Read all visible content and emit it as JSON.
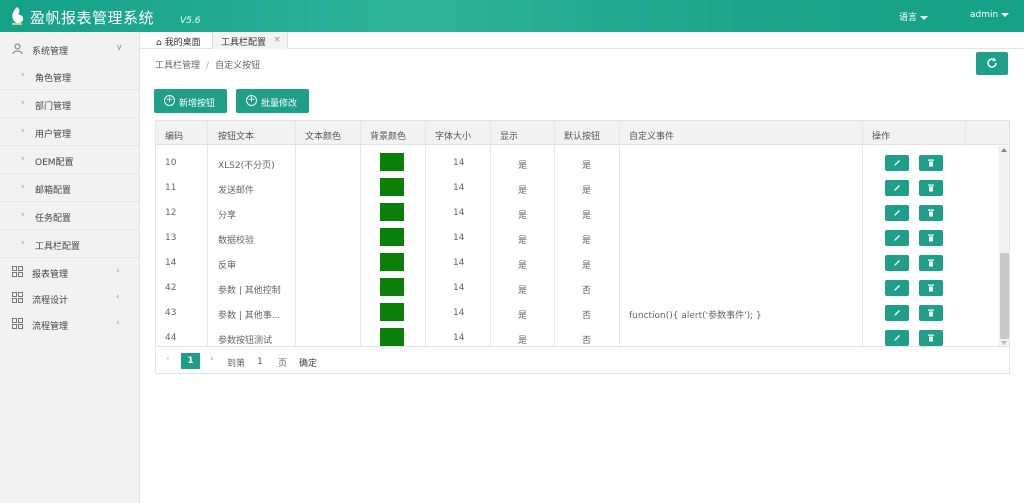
{
  "header": {
    "title": "盈帆报表管理系统",
    "version": "V5.6",
    "language": "语言",
    "user": "admin"
  },
  "sidebar": {
    "groups": [
      {
        "label": "系统管理",
        "icon": "user-icon",
        "expanded": true
      },
      {
        "label": "报表管理",
        "icon": "grid-icon",
        "expanded": false
      },
      {
        "label": "流程设计",
        "icon": "grid-icon",
        "expanded": false
      },
      {
        "label": "流程管理",
        "icon": "grid-icon",
        "expanded": false
      }
    ],
    "sub_items": [
      "角色管理",
      "部门管理",
      "用户管理",
      "OEM配置",
      "邮箱配置",
      "任务配置",
      "工具栏配置"
    ]
  },
  "tabs": {
    "home": "我的桌面",
    "active": "工具栏配置"
  },
  "breadcrumb": {
    "parent": "工具栏管理",
    "current": "自定义按钮"
  },
  "actions": {
    "add": "新增按钮",
    "batch_edit": "批量修改"
  },
  "table": {
    "columns": [
      "编码",
      "按钮文本",
      "文本颜色",
      "背景颜色",
      "字体大小",
      "显示",
      "默认按钮",
      "自定义事件",
      "操作"
    ],
    "rows": [
      {
        "code": "10",
        "text": "XLS2(不分页)",
        "color": "",
        "bg": "#0a7f0a",
        "size": "14",
        "show": "是",
        "default": "是",
        "event": ""
      },
      {
        "code": "11",
        "text": "发送邮件",
        "color": "",
        "bg": "#0a7f0a",
        "size": "14",
        "show": "是",
        "default": "是",
        "event": ""
      },
      {
        "code": "12",
        "text": "分享",
        "color": "",
        "bg": "#0a7f0a",
        "size": "14",
        "show": "是",
        "default": "是",
        "event": ""
      },
      {
        "code": "13",
        "text": "数据校验",
        "color": "",
        "bg": "#0a7f0a",
        "size": "14",
        "show": "是",
        "default": "是",
        "event": ""
      },
      {
        "code": "14",
        "text": "反审",
        "color": "",
        "bg": "#0a7f0a",
        "size": "14",
        "show": "是",
        "default": "是",
        "event": ""
      },
      {
        "code": "42",
        "text": "参数 | 其他控制",
        "color": "",
        "bg": "#0a7f0a",
        "size": "14",
        "show": "是",
        "default": "否",
        "event": ""
      },
      {
        "code": "43",
        "text": "参数 | 其他事...",
        "color": "",
        "bg": "#0a7f0a",
        "size": "14",
        "show": "是",
        "default": "否",
        "event": "function(){ alert('参数事件'); }"
      },
      {
        "code": "44",
        "text": "参数按钮测试",
        "color": "",
        "bg": "#0a7f0a",
        "size": "14",
        "show": "是",
        "default": "否",
        "event": ""
      }
    ]
  },
  "pager": {
    "current": "1",
    "goto": "到第",
    "input": "1",
    "page": "页",
    "ok": "确定"
  }
}
